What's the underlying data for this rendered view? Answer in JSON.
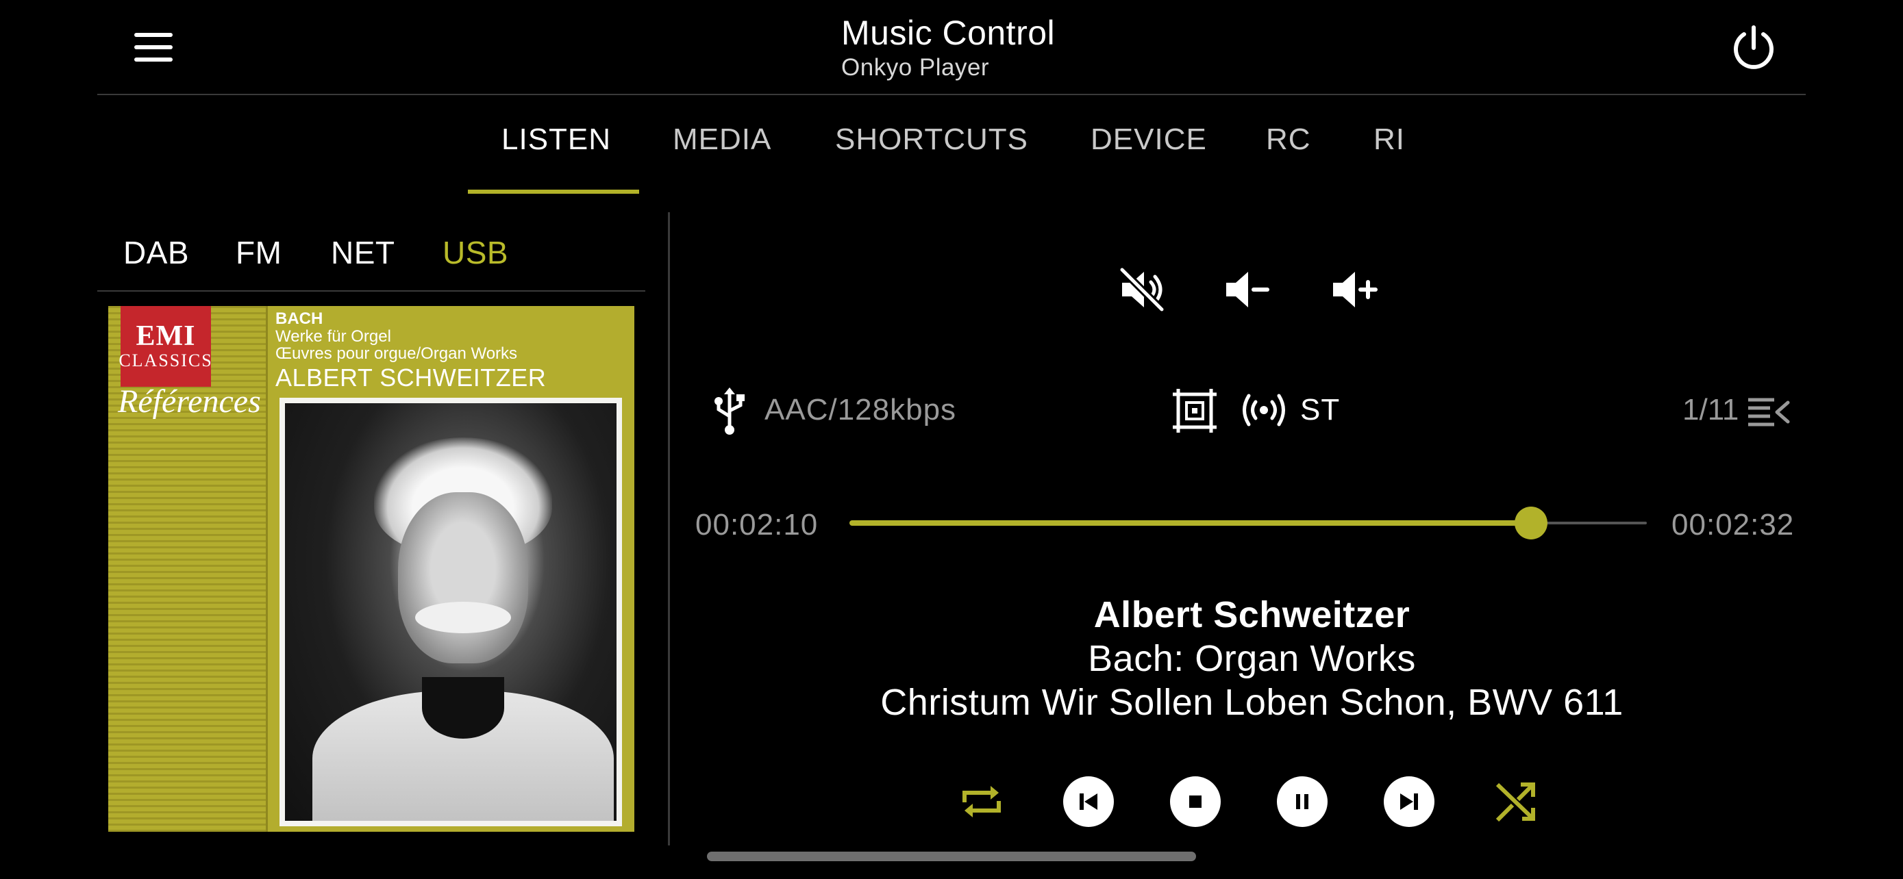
{
  "header": {
    "title": "Music Control",
    "subtitle": "Onkyo Player"
  },
  "tabs": [
    {
      "label": "LISTEN",
      "active": true
    },
    {
      "label": "MEDIA",
      "active": false
    },
    {
      "label": "SHORTCUTS",
      "active": false
    },
    {
      "label": "DEVICE",
      "active": false
    },
    {
      "label": "RC",
      "active": false
    },
    {
      "label": "RI",
      "active": false
    }
  ],
  "sources": [
    {
      "label": "DAB",
      "active": false
    },
    {
      "label": "FM",
      "active": false
    },
    {
      "label": "NET",
      "active": false
    },
    {
      "label": "USB",
      "active": true
    }
  ],
  "album_art": {
    "label_brand": "EMI",
    "label_series": "CLASSICS",
    "series_name": "Références",
    "composer": "BACH",
    "line2": "Werke für Orgel",
    "line3": "Œuvres pour orgue/Organ Works",
    "artist": "ALBERT SCHWEITZER"
  },
  "info": {
    "codec": "AAC/128kbps",
    "stereo": "ST",
    "track_position": "1/11"
  },
  "progress": {
    "elapsed": "00:02:10",
    "total": "00:02:32",
    "fraction": 0.855
  },
  "track": {
    "artist": "Albert Schweitzer",
    "album": "Bach: Organ Works",
    "title": "Christum Wir Sollen Loben Schon, BWV 611"
  },
  "colors": {
    "accent": "#b2b22a",
    "background": "#000000",
    "muted_text": "#9a9a9a",
    "divider": "#3a3a3a"
  },
  "icons": {
    "menu": "hamburger-menu-icon",
    "power": "power-icon",
    "mute": "volume-mute-icon",
    "vol_down": "volume-down-icon",
    "vol_up": "volume-up-icon",
    "usb": "usb-icon",
    "input": "input-selector-icon",
    "tuner": "broadcast-icon",
    "playlist": "playlist-icon",
    "repeat": "repeat-icon",
    "previous": "skip-previous-icon",
    "stop": "stop-icon",
    "pause": "pause-icon",
    "next": "skip-next-icon",
    "shuffle": "shuffle-icon"
  }
}
